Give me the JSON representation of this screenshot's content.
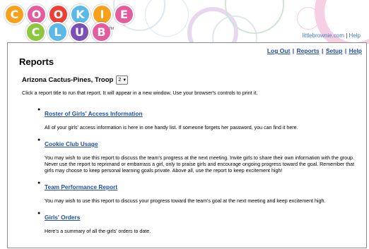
{
  "header": {
    "logo_row1": [
      "C",
      "O",
      "O",
      "K",
      "I",
      "E"
    ],
    "logo_row2": [
      "C",
      "L",
      "U",
      "B"
    ],
    "logo_colors_row1": [
      "#f6a11c",
      "#e45ba0",
      "#ee3f37",
      "#5cb8e6",
      "#f6a11c",
      "#e45ba0"
    ],
    "logo_colors_row2": [
      "#8dc63f",
      "#5cb8e6",
      "#7b4fb5",
      "#e45ba0"
    ],
    "trademark": "TM",
    "site_link": "littlebrownie.com",
    "help_link": "Help",
    "separator": "|"
  },
  "nav": {
    "logout": "Log Out",
    "reports": "Reports",
    "setup": "Setup",
    "help": "Help",
    "separator": "|"
  },
  "page": {
    "title": "Reports",
    "troop_label": "Arizona Cactus-Pines, Troop",
    "troop_value": "2",
    "intro": "Click a report title to run that report. It will appear in a new window. Use your browser's controls to print it."
  },
  "reports": [
    {
      "title": "Roster of Girls' Access Information",
      "description": "All of your girls' access information is here in one handy list. If someone forgets her password, you can find it here."
    },
    {
      "title": "Cookie Club Usage",
      "description": "You may wish to use this report to discuss the team's progress at the next meeting. Invite girls to share their own information with the group. Never use the report to reprimand or embarrass a girl, only to praise girls and encourage ongoing progress toward the goal. Remember that girls may choose to keep personal learning goals private. Above all, use the report to keep excitement high!"
    },
    {
      "title": "Team Performance Report",
      "description": "You may wish to use this report to discuss your progress toward the team's goal at the next meeting and keep excitement high."
    },
    {
      "title": "Girls' Orders",
      "description": "Here's a summary of all the girls' orders to date."
    }
  ]
}
